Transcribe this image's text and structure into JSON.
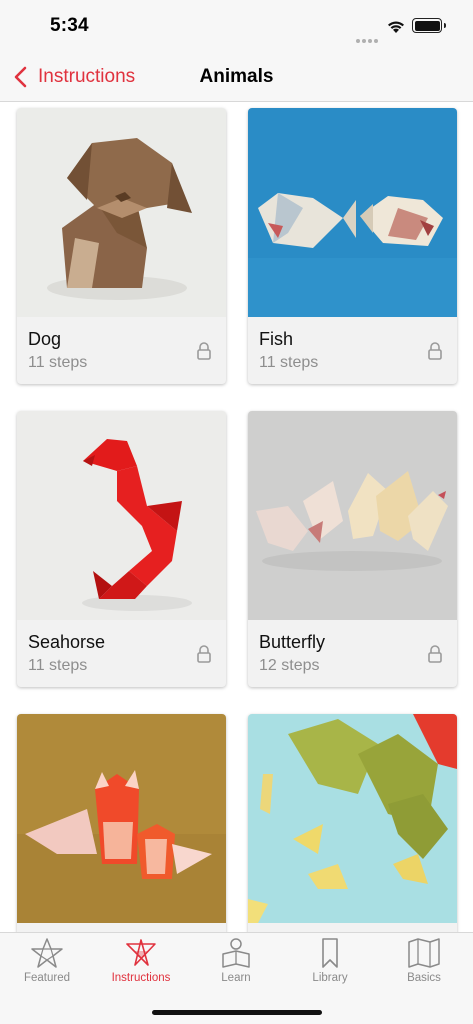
{
  "status_bar": {
    "time": "5:34"
  },
  "nav": {
    "back_label": "Instructions",
    "title": "Animals"
  },
  "models": [
    {
      "title": "Dog",
      "steps": "11 steps",
      "locked": true
    },
    {
      "title": "Fish",
      "steps": "11 steps",
      "locked": true
    },
    {
      "title": "Seahorse",
      "steps": "11 steps",
      "locked": true
    },
    {
      "title": "Butterfly",
      "steps": "12 steps",
      "locked": true
    },
    {
      "title": "",
      "steps": "",
      "locked": false
    },
    {
      "title": "",
      "steps": "",
      "locked": false
    }
  ],
  "tabs": [
    {
      "label": "Featured",
      "icon": "star-icon",
      "active": false
    },
    {
      "label": "Instructions",
      "icon": "origami-star-icon",
      "active": true
    },
    {
      "label": "Learn",
      "icon": "learn-icon",
      "active": false
    },
    {
      "label": "Library",
      "icon": "bookmark-icon",
      "active": false
    },
    {
      "label": "Basics",
      "icon": "map-icon",
      "active": false
    }
  ],
  "colors": {
    "accent": "#e0323e",
    "inactive": "#8a8a8a",
    "bar_background": "#f7f7f7"
  }
}
